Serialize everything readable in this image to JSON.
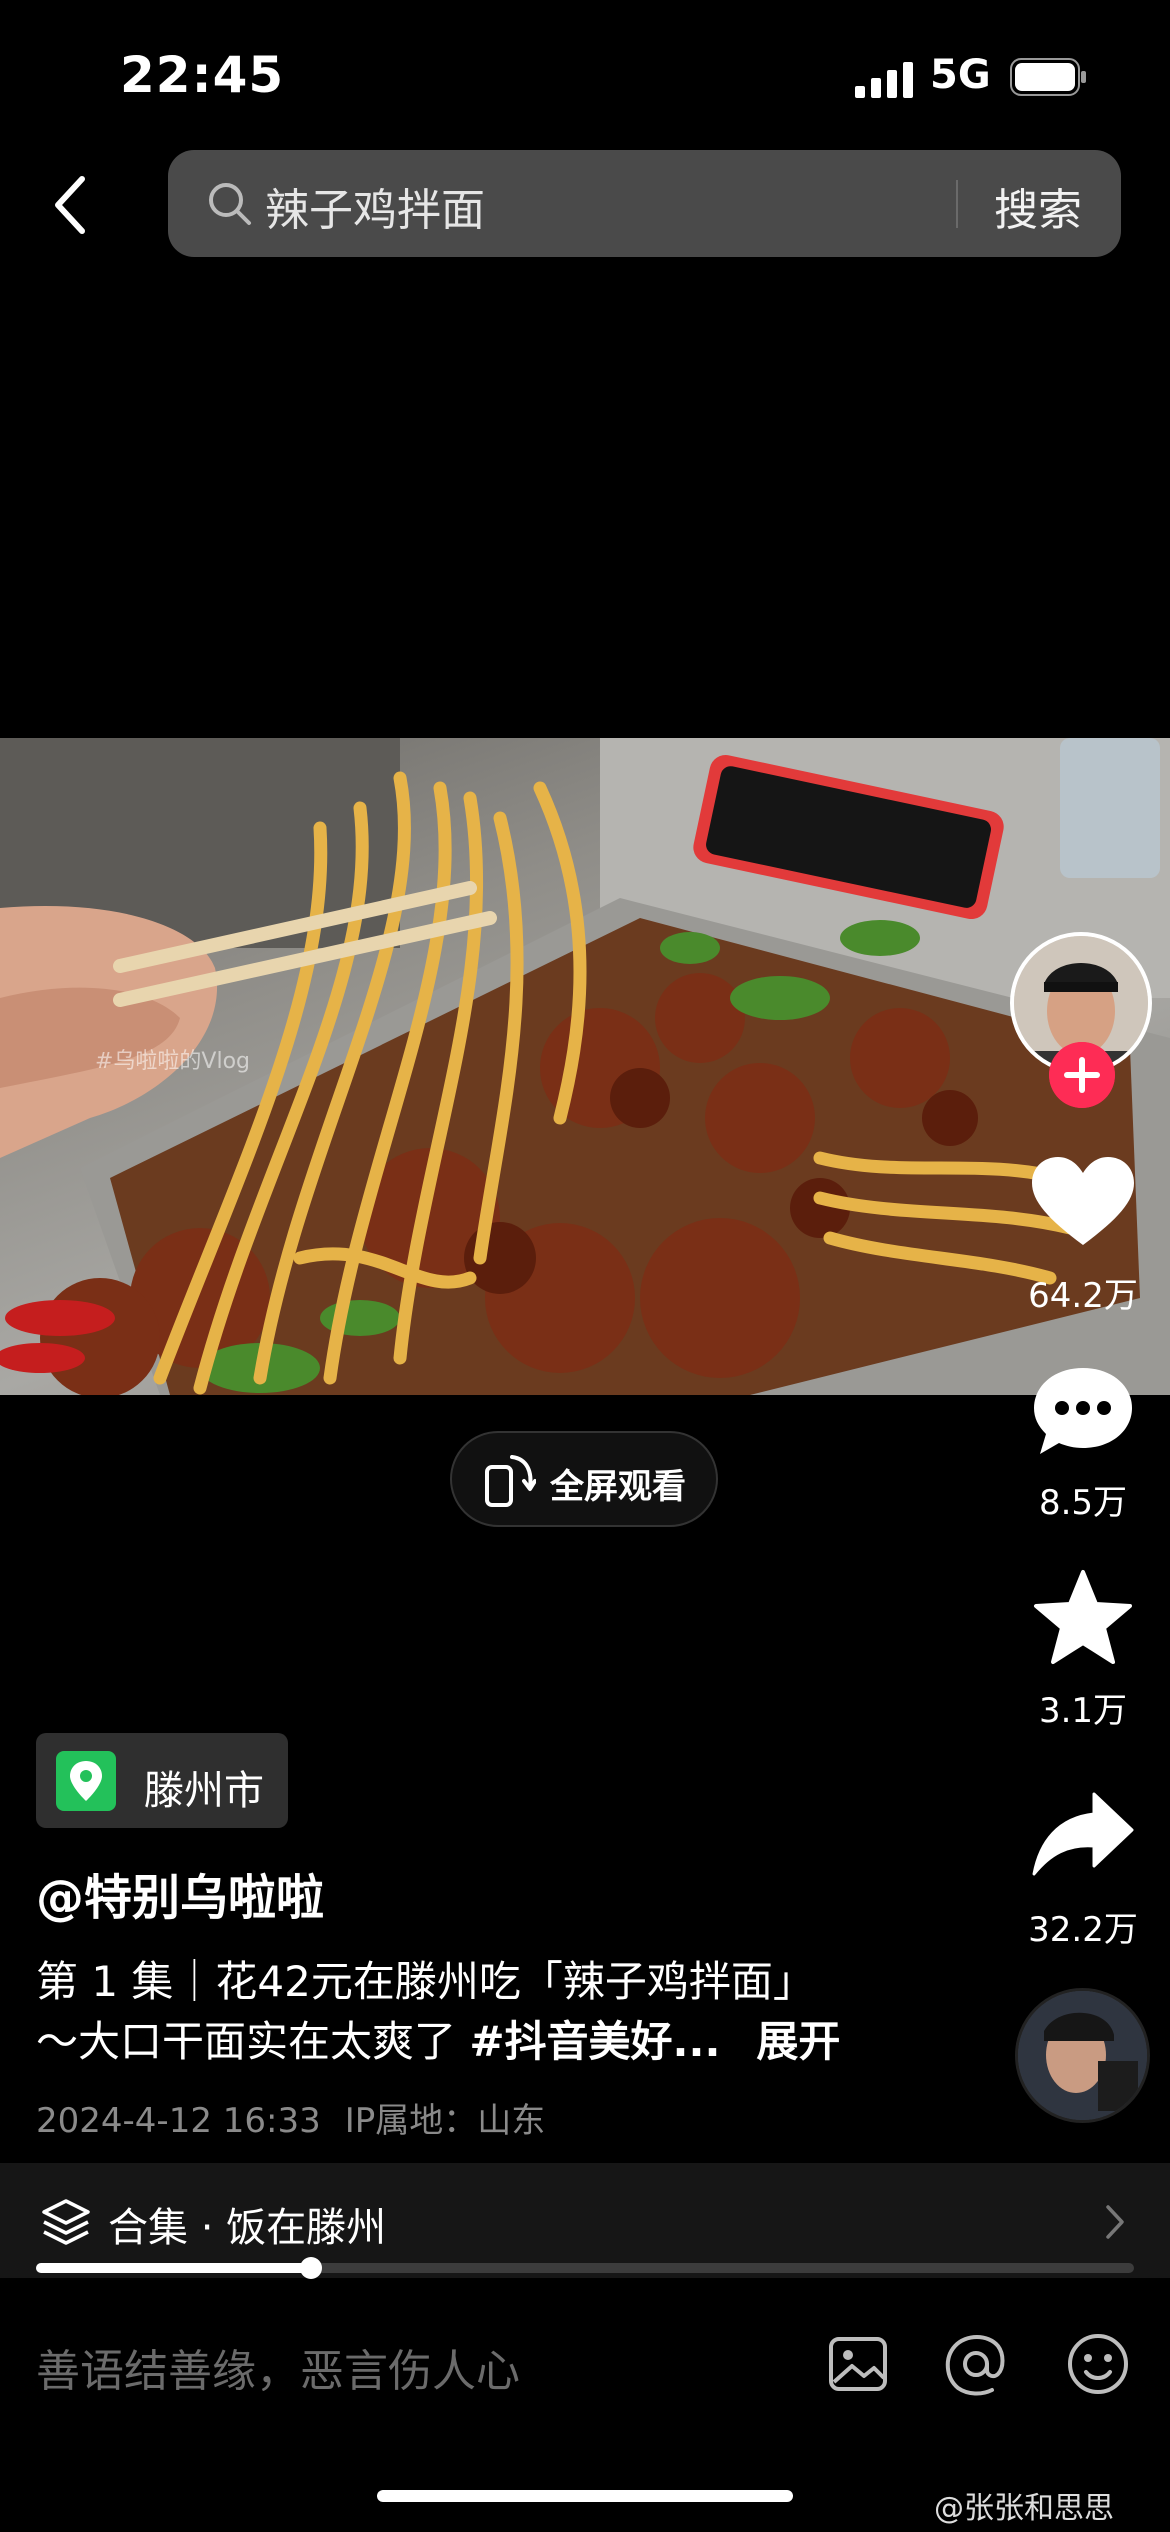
{
  "status_bar": {
    "time": "22:45",
    "network": "5G"
  },
  "search": {
    "query": "辣子鸡拌面",
    "button": "搜索"
  },
  "video": {
    "watermark": "#乌啦啦的Vlog"
  },
  "fullscreen": {
    "label": "全屏观看"
  },
  "actions": {
    "likes": "64.2万",
    "comments": "8.5万",
    "favorites": "3.1万",
    "shares": "32.2万"
  },
  "location": {
    "label": "滕州市"
  },
  "author": "@特别乌啦啦",
  "description": {
    "line1": "第 1 集｜花42元在滕州吃「辣子鸡拌面」",
    "line2_text": "～大口干面实在太爽了 ",
    "hashtag": "#抖音美好...",
    "expand": "展开"
  },
  "meta": {
    "datetime": "2024-4-12 16:33",
    "ip_location": "IP属地：山东"
  },
  "collection": {
    "label": "合集 · 饭在滕州",
    "progress": 0.25
  },
  "comment_box": {
    "placeholder": "善语结善缘，恶言伤人心"
  },
  "overlay": {
    "watermark": "@张张和思思"
  },
  "colors": {
    "follow": "#fe2c55",
    "location_icon": "#23c15a",
    "search_bg": "#4a4a4a"
  },
  "icons": [
    "back-icon",
    "search-icon",
    "heart-icon",
    "comment-icon",
    "star-icon",
    "share-icon",
    "fullscreen-icon",
    "collection-icon",
    "image-icon",
    "at-icon",
    "emoji-icon"
  ]
}
